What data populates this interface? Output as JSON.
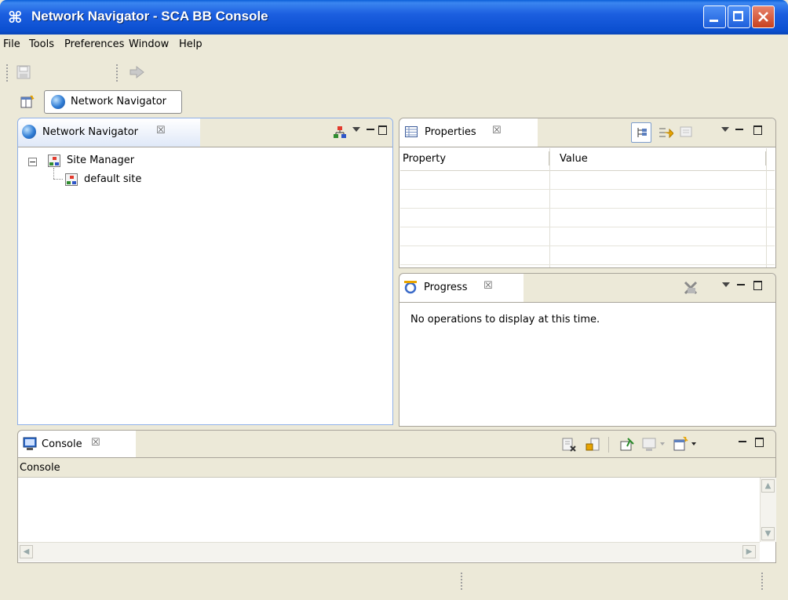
{
  "window": {
    "title": "Network Navigator - SCA BB Console",
    "app_icon": "⌘"
  },
  "menu": {
    "items": [
      "File",
      "Tools",
      "Preferences",
      "Window",
      "Help"
    ]
  },
  "toolbar": {
    "icons": [
      "save-icon",
      "forward-arrow-icon"
    ]
  },
  "perspective": {
    "label": "Network Navigator",
    "icons": [
      "open-perspective-icon",
      "network-globe-icon"
    ]
  },
  "navigator_view": {
    "tab_label": "Network Navigator",
    "close_glyph": "☒",
    "tree": {
      "root_label": "Site Manager",
      "root_expander": "−",
      "children": [
        "default site"
      ]
    }
  },
  "properties_view": {
    "tab_label": "Properties",
    "close_glyph": "☒",
    "columns": [
      "Property",
      "Value"
    ]
  },
  "progress_view": {
    "tab_label": "Progress",
    "close_glyph": "☒",
    "message": "No operations to display at this time."
  },
  "console_view": {
    "tab_label": "Console",
    "close_glyph": "☒",
    "header_label": "Console"
  },
  "colors": {
    "titlebar": "#0b4fd0",
    "active_border": "#8fb0e8",
    "chrome_bg": "#ece9d8"
  }
}
